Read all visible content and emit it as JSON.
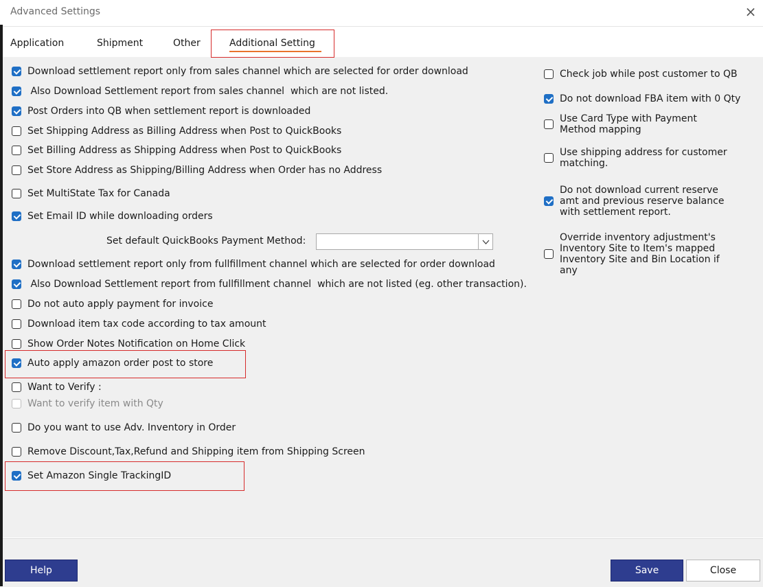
{
  "window": {
    "title": "Advanced Settings",
    "close_glyph": "×"
  },
  "tabs": [
    {
      "label": "Application",
      "active": false
    },
    {
      "label": "Shipment",
      "active": false
    },
    {
      "label": "Other",
      "active": false
    },
    {
      "label": "Additional Setting",
      "active": true
    }
  ],
  "left_options": [
    {
      "label": "Download settlement report only from sales channel which are selected for order download",
      "checked": true
    },
    {
      "label": " Also Download Settlement report from sales channel  which are not listed.",
      "checked": true
    },
    {
      "label": "Post Orders into QB when settlement report is downloaded",
      "checked": true
    },
    {
      "label": "Set Shipping Address as Billing Address when Post to QuickBooks",
      "checked": false
    },
    {
      "label": "Set Billing Address as Shipping Address when Post to QuickBooks",
      "checked": false
    },
    {
      "label": "Set Store Address as Shipping/Billing Address when Order has no Address",
      "checked": false
    },
    {
      "label": "Set MultiState Tax for Canada",
      "checked": false
    },
    {
      "label": "Set Email ID while downloading orders",
      "checked": true
    },
    {
      "label": "Download settlement report only from fullfillment channel which are selected for order download",
      "checked": true
    },
    {
      "label": " Also Download Settlement report from fullfillment channel  which are not listed (eg. other transaction).",
      "checked": true
    },
    {
      "label": "Do not auto apply payment for invoice",
      "checked": false
    },
    {
      "label": "Download item tax code according to tax amount",
      "checked": false
    },
    {
      "label": "Show Order Notes Notification on Home Click",
      "checked": false
    },
    {
      "label": "Auto apply amazon order post to store",
      "checked": true
    },
    {
      "label": "Want to Verify :",
      "checked": false
    },
    {
      "label": "Want to verify item with Qty",
      "checked": false,
      "disabled": true
    },
    {
      "label": "Do you want to use Adv. Inventory in Order",
      "checked": false
    },
    {
      "label": "Remove Discount,Tax,Refund and Shipping item from Shipping Screen",
      "checked": false
    },
    {
      "label": "Set Amazon Single TrackingID",
      "checked": true
    }
  ],
  "payment_method": {
    "label": "Set default QuickBooks Payment Method:",
    "value": ""
  },
  "right_options": [
    {
      "label": "Check job while post customer to QB",
      "checked": false
    },
    {
      "label": "Do not download FBA item with 0 Qty",
      "checked": true
    },
    {
      "label": "Use Card Type with Payment Method mapping",
      "checked": false
    },
    {
      "label": "Use shipping address for customer matching.",
      "checked": false
    },
    {
      "label": "Do not download current reserve amt and previous reserve balance with settlement report.",
      "checked": true
    },
    {
      "label": "Override inventory adjustment's Inventory Site to Item's mapped Inventory Site and Bin Location if any",
      "checked": false
    }
  ],
  "footer": {
    "help_label": "Help",
    "save_label": "Save",
    "close_label": "Close"
  },
  "colors": {
    "accent_blue": "#2e3d8f",
    "checkbox_blue": "#1f6fc5",
    "highlight_red": "#d62a2a",
    "tab_underline": "#e8722c"
  }
}
